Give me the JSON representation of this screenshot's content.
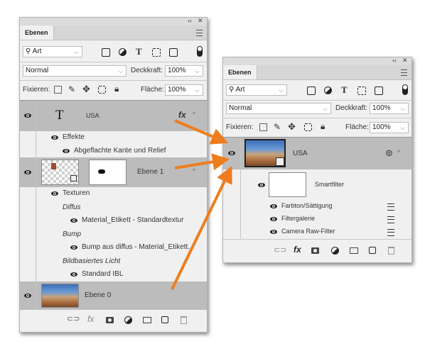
{
  "left_panel": {
    "window_controls": {
      "collapse": "‹‹",
      "close": "✕"
    },
    "tab_label": "Ebenen",
    "filter": {
      "kind_label": "Art",
      "filter_icons": [
        "image-icon",
        "adjustment-icon",
        "type-icon",
        "shape-icon",
        "smart-object-icon"
      ]
    },
    "blend": {
      "mode": "Normal",
      "opacity_label": "Deckkraft:",
      "opacity_value": "100%"
    },
    "lock": {
      "label": "Fixieren:",
      "fill_label": "Fläche:",
      "fill_value": "100%"
    },
    "layers": {
      "usa": {
        "name": "USA",
        "type_glyph": "T",
        "fx_badge": "fx"
      },
      "effects": {
        "label": "Effekte",
        "items": [
          "Abgeflachte Kante und Relief"
        ]
      },
      "ebene1": {
        "name": "Ebene 1"
      },
      "textures": {
        "label": "Texturen",
        "groups": [
          {
            "heading": "Diffus",
            "item": "Material_Etikett - Standardtextur"
          },
          {
            "heading": "Bump",
            "item": "Bump aus diffus - Material_Etikett..."
          },
          {
            "heading": "Bildbasiertes Licht",
            "item": "Standard IBL"
          }
        ]
      },
      "ebene0": {
        "name": "Ebene 0"
      }
    },
    "bottom_icons": [
      "link-icon",
      "fx-icon",
      "mask-icon",
      "adjustment-layer-icon",
      "folder-icon",
      "new-layer-icon",
      "trash-icon"
    ],
    "fx_label": "fx"
  },
  "right_panel": {
    "window_controls": {
      "collapse": "‹‹",
      "close": "✕"
    },
    "tab_label": "Ebenen",
    "filter": {
      "kind_label": "Art"
    },
    "blend": {
      "mode": "Normal",
      "opacity_label": "Deckkraft:",
      "opacity_value": "100%"
    },
    "lock": {
      "label": "Fixieren:",
      "fill_label": "Fläche:",
      "fill_value": "100%"
    },
    "layers": {
      "usa": {
        "name": "USA"
      },
      "smartfilter": {
        "label": "Smartfilter",
        "items": [
          "Farbton/Sättigung",
          "Filtergalerie",
          "Camera Raw-Filter"
        ]
      }
    },
    "fx_label": "fx"
  },
  "arrow_color": "#ee7d1e",
  "selection_color": "#bcbcbc"
}
